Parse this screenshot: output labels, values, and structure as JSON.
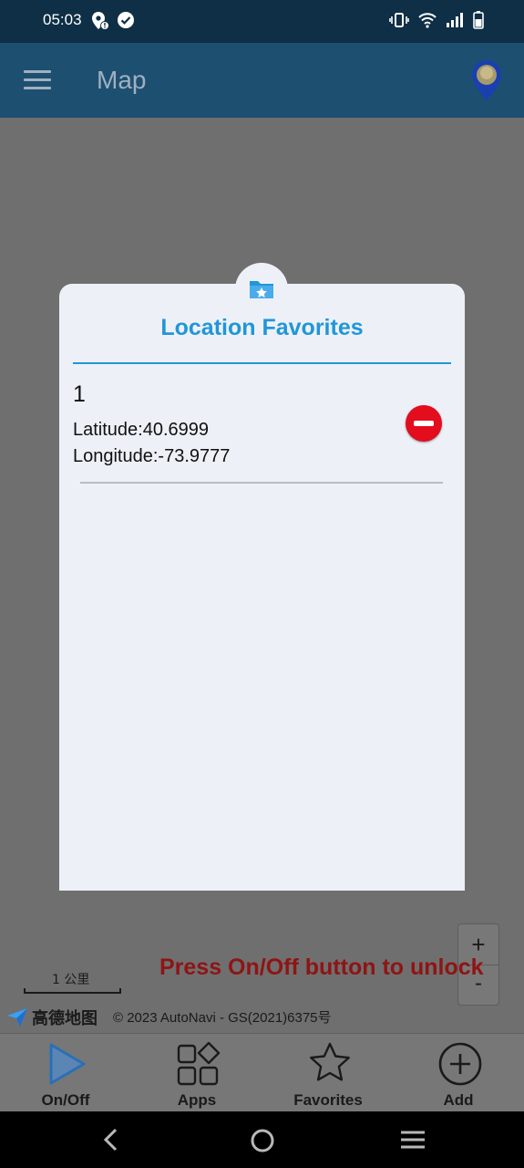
{
  "status": {
    "time": "05:03",
    "icons_left": [
      "location-alert-icon",
      "check-circle-icon"
    ],
    "icons_right": [
      "vibrate-icon",
      "wifi-icon",
      "signal-icon",
      "battery-icon"
    ]
  },
  "appbar": {
    "title": "Map",
    "menu_icon": "hamburger-menu-icon",
    "pin_icon": "location-pin-icon"
  },
  "modal": {
    "header_icon": "star-folder-icon",
    "title": "Location Favorites",
    "items": [
      {
        "name": "1",
        "latitude": "Latitude:40.6999",
        "longitude": "Longitude:-73.9777",
        "remove_icon": "remove-circle-icon"
      }
    ]
  },
  "map": {
    "zoom_in": "+",
    "zoom_out": "-",
    "unlock_message": "Press On/Off button to unlock",
    "scale_label": "1 公里",
    "logo_text": "高德地图",
    "copyright": "© 2023 AutoNavi - GS(2021)6375号"
  },
  "bottom_nav": [
    {
      "label": "On/Off",
      "icon": "play-icon"
    },
    {
      "label": "Apps",
      "icon": "apps-grid-icon"
    },
    {
      "label": "Favorites",
      "icon": "star-icon"
    },
    {
      "label": "Add",
      "icon": "add-circle-icon"
    }
  ],
  "system_nav": [
    "back-icon",
    "home-icon",
    "recents-icon"
  ],
  "colors": {
    "statusbar": "#0e2f45",
    "appbar": "#1d4f70",
    "accent": "#2196d8",
    "remove": "#e30d1d",
    "unlock_text": "#8f1414"
  }
}
